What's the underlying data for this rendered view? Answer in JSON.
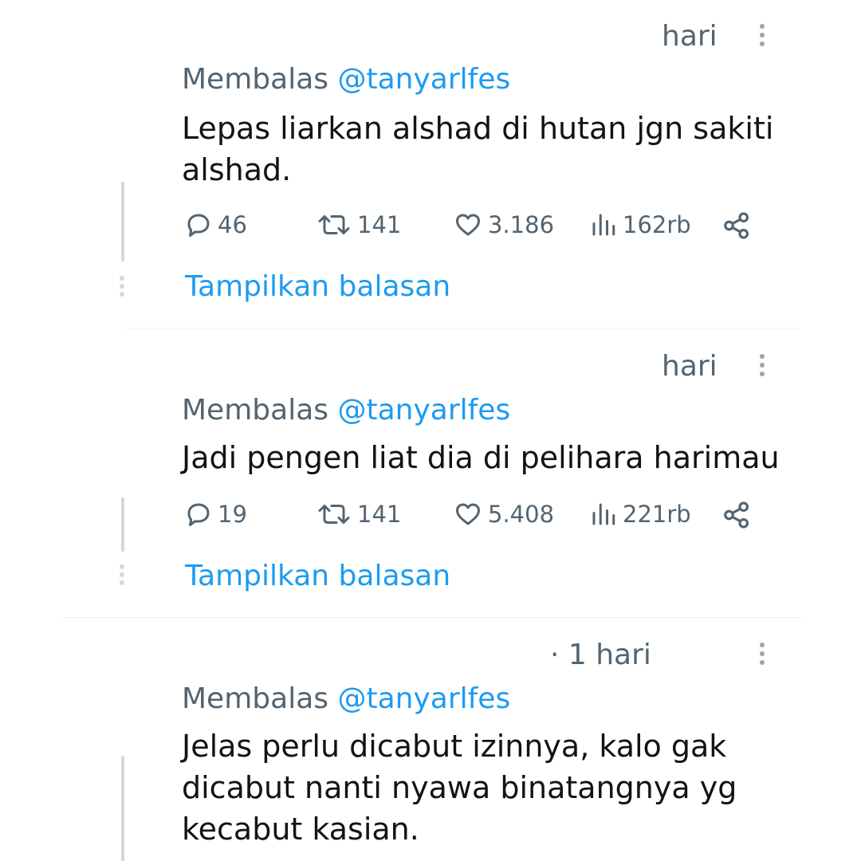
{
  "tweets": [
    {
      "time": "hari",
      "reply_prefix": "Membalas",
      "reply_handle": "@tanyarlfes",
      "text_lines": [
        "Lepas liarkan alshad di hutan jgn sakiti",
        "alshad."
      ],
      "replies": "46",
      "retweets": "141",
      "likes": "3.186",
      "views": "162rb",
      "show_replies": "Tampilkan balasan"
    },
    {
      "time": "hari",
      "reply_prefix": "Membalas",
      "reply_handle": "@tanyarlfes",
      "text_lines": [
        "Jadi pengen liat dia di pelihara harimau"
      ],
      "replies": "19",
      "retweets": "141",
      "likes": "5.408",
      "views": "221rb",
      "show_replies": "Tampilkan balasan"
    },
    {
      "time": "· 1 hari",
      "reply_prefix": "Membalas",
      "reply_handle": "@tanyarlfes",
      "text_lines": [
        "Jelas perlu dicabut izinnya, kalo gak",
        "dicabut nanti nyawa binatangnya yg",
        "kecabut kasian."
      ]
    }
  ],
  "icons": {
    "reply": "speech-bubble",
    "retweet": "retweet-arrows",
    "like": "heart-outline",
    "views": "bar-chart",
    "share": "share-nodes",
    "more": "vertical-ellipsis"
  },
  "colors": {
    "text": "#0f1419",
    "secondary": "#536471",
    "accent": "#1d9bf0",
    "divider": "#eff3f4"
  }
}
